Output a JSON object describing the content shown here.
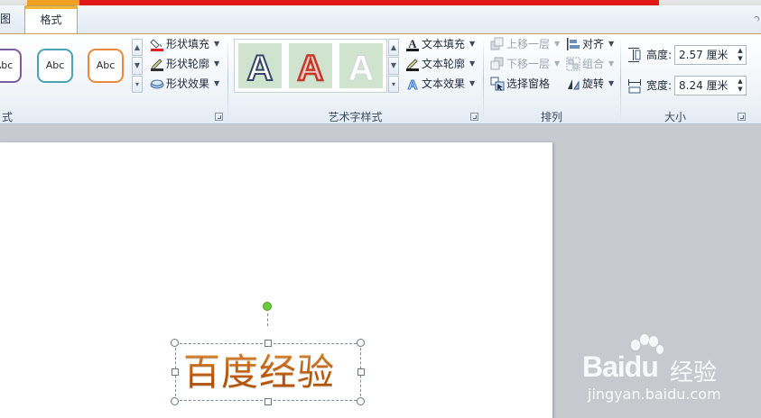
{
  "tabs": {
    "partial_tab": "图",
    "active_tab": "格式"
  },
  "shape_styles": {
    "items": [
      {
        "label": "Abc",
        "color": "#7a5ca0"
      },
      {
        "label": "Abc",
        "color": "#4aa3b5"
      },
      {
        "label": "Abc",
        "color": "#e88a3c"
      }
    ],
    "fill": "形状填充",
    "outline": "形状轮廓",
    "effect": "形状效果",
    "group_label": "式"
  },
  "wordart_styles": {
    "items": [
      "A",
      "A",
      "A"
    ],
    "text_fill": "文本填充",
    "text_outline": "文本轮廓",
    "text_effect": "文本效果",
    "group_label": "艺术字样式"
  },
  "arrange": {
    "bring_forward": "上移一层",
    "send_backward": "下移一层",
    "selection_pane": "选择窗格",
    "align": "对齐",
    "group": "组合",
    "rotate": "旋转",
    "group_label": "排列"
  },
  "size": {
    "height_label": "高度:",
    "height_value": "2.57 厘米",
    "width_label": "宽度:",
    "width_value": "8.24 厘米",
    "group_label": "大小"
  },
  "slide": {
    "wordart_text": "百度经验"
  },
  "watermark": {
    "logo": "Baidu",
    "text": "经验",
    "url": "jingyan.baidu.com"
  },
  "colors": {
    "accent": "#f0b63a",
    "wordart": "#d4711a",
    "title_red": "#e01818"
  }
}
